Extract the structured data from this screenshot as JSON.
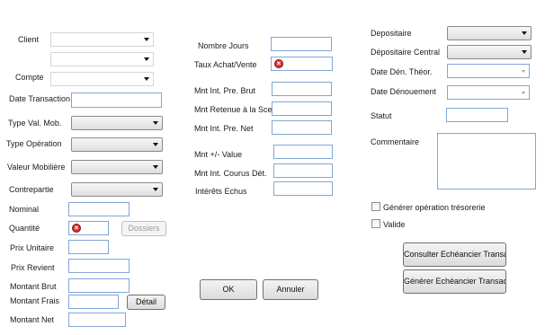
{
  "left": {
    "client_label": "Client",
    "compte_label": "Compte",
    "date_transaction_label": "Date Transaction",
    "type_val_mob_label": "Type Val. Mob.",
    "type_operation_label": "Type Opération",
    "valeur_mobiliere_label": "Valeur Mobilière",
    "contrepartie_label": "Contrepartie",
    "nominal_label": "Nominal",
    "quantite_label": "Quantité",
    "dossiers_button": "Dossiers",
    "prix_unitaire_label": "Prix Unitaire",
    "prix_revient_label": "Prix Revient",
    "montant_brut_label": "Montant Brut",
    "montant_frais_label": "Montant Frais",
    "detail_button": "Détail",
    "montant_net_label": "Montant Net"
  },
  "middle": {
    "nombre_jours_label": "Nombre Jours",
    "taux_achat_vente_label": "Taux Achat/Vente",
    "mnt_int_pre_brut_label": "Mnt Int. Pre. Brut",
    "mnt_retenue_label": "Mnt Retenue à la Sce",
    "mnt_int_pre_net_label": "Mnt Int. Pre. Net",
    "mnt_plus_minus_value_label": "Mnt +/-  Value",
    "mnt_int_courus_label": "Mnt Int. Courus Dét.",
    "interets_echus_label": "Intérêts Echus",
    "ok_button": "OK",
    "annuler_button": "Annuler"
  },
  "right": {
    "depositaire_label": "Depositaire",
    "depositaire_central_label": "Dépositaire Central",
    "date_den_theor_label": "Date Dén. Théor.",
    "date_denouement_label": "Date Dénouement",
    "statut_label": "Statut",
    "commentaire_label": "Commentaire",
    "generer_operation_label": "Générer opération trésorerie",
    "valide_label": "Valide",
    "consulter_button": "Consulter Echéancier Transac",
    "generer_echeancier_button": "Générer Echéancier Transac."
  },
  "icons": {
    "error": "error-icon",
    "dropdown": "chevron-down-icon"
  },
  "colors": {
    "input_border": "#7fa7d6",
    "error_red": "#d42a2a"
  }
}
